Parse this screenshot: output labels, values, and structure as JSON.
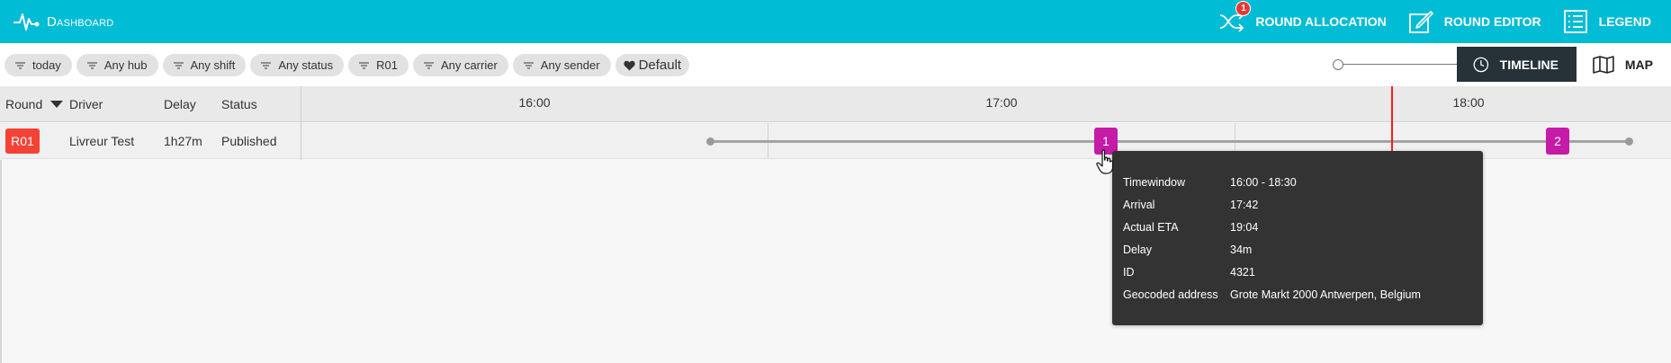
{
  "app": {
    "title": "Dashboard",
    "brand_color": "#00bcd4",
    "brand_icon": "heartbeat-icon"
  },
  "nav": {
    "round_allocation": {
      "label": "ROUND ALLOCATION",
      "badge": "1",
      "icon": "shuffle-icon"
    },
    "round_editor": {
      "label": "ROUND EDITOR",
      "icon": "edit-icon"
    },
    "legend": {
      "label": "LEGEND",
      "icon": "list-icon"
    }
  },
  "filters": {
    "chips": [
      "today",
      "Any hub",
      "Any shift",
      "Any status",
      "R01",
      "Any carrier",
      "Any sender"
    ],
    "default_label": "Default",
    "filter_icon": "filter-icon",
    "default_icon": "heart-icon"
  },
  "views": {
    "timeline": {
      "label": "TIMELINE",
      "icon": "clock-icon",
      "active": true
    },
    "map": {
      "label": "MAP",
      "icon": "map-icon"
    }
  },
  "table": {
    "columns": {
      "round": "Round",
      "driver": "Driver",
      "delay": "Delay",
      "status": "Status"
    },
    "hours": [
      "16:00",
      "17:00",
      "18:00"
    ],
    "rows": [
      {
        "round": "R01",
        "driver": "Livreur Test",
        "delay": "1h27m",
        "status": "Published"
      }
    ]
  },
  "stops": [
    "1",
    "2"
  ],
  "colors": {
    "round_tag": "#f44336",
    "stop": "#c51ba7",
    "now_line": "#ff1a1a",
    "timeline_active": "#263238"
  },
  "tooltip": {
    "rows": [
      {
        "label": "Timewindow",
        "value": "16:00 - 18:30"
      },
      {
        "label": "Arrival",
        "value": "17:42"
      },
      {
        "label": "Actual ETA",
        "value": "19:04"
      },
      {
        "label": "Delay",
        "value": "34m"
      },
      {
        "label": "ID",
        "value": "4321"
      },
      {
        "label": "Geocoded address",
        "value": "Grote Markt 2000 Antwerpen, Belgium"
      }
    ]
  }
}
